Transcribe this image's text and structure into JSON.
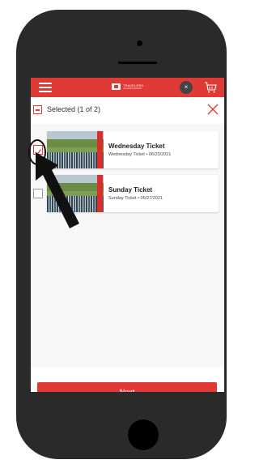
{
  "header": {
    "brand": "TRAVELERS",
    "brand_sub": "CHAMPIONSHIP",
    "close_symbol": "×",
    "icons": [
      "hamburger-icon",
      "close-icon",
      "cart-icon"
    ]
  },
  "selection": {
    "label": "Selected (1 of 2)"
  },
  "tickets": [
    {
      "title": "Wednesday Ticket",
      "subtitle": "Wednesday Ticket • 06/23/2021",
      "checked": true
    },
    {
      "title": "Sunday Ticket",
      "subtitle": "Sunday Ticket • 06/27/2021",
      "checked": false
    }
  ],
  "footer": {
    "next_label": "Next"
  },
  "colors": {
    "accent": "#e03a36",
    "phone": "#2a2a2a"
  }
}
